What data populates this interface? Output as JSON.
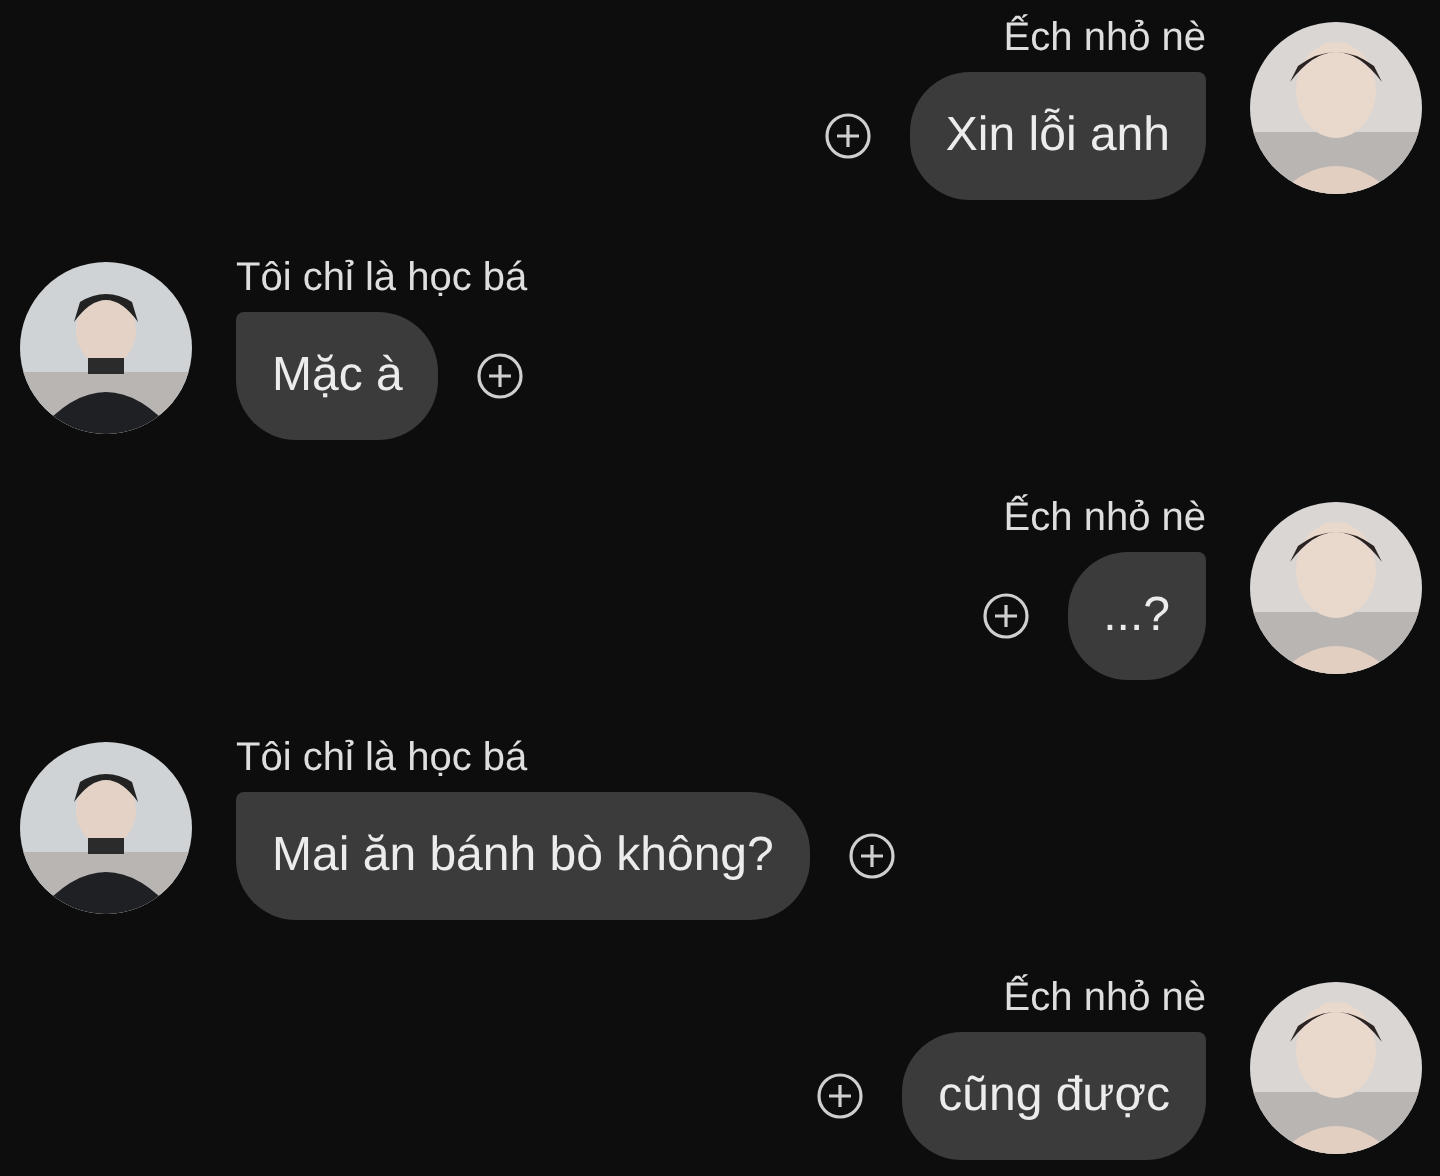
{
  "messages": [
    {
      "kind": "outgoing",
      "sender": "Ếch nhỏ nè",
      "text": "Xin lỗi anh"
    },
    {
      "kind": "incoming",
      "sender": "Tôi chỉ là học bá",
      "text": "Mặc à"
    },
    {
      "kind": "outgoing",
      "sender": "Ếch nhỏ nè",
      "text": "...?"
    },
    {
      "kind": "incoming",
      "sender": "Tôi chỉ là học bá",
      "text": "Mai ăn bánh bò không?"
    },
    {
      "kind": "outgoing",
      "sender": "Ếch nhỏ nè",
      "text": "cũng được"
    }
  ]
}
